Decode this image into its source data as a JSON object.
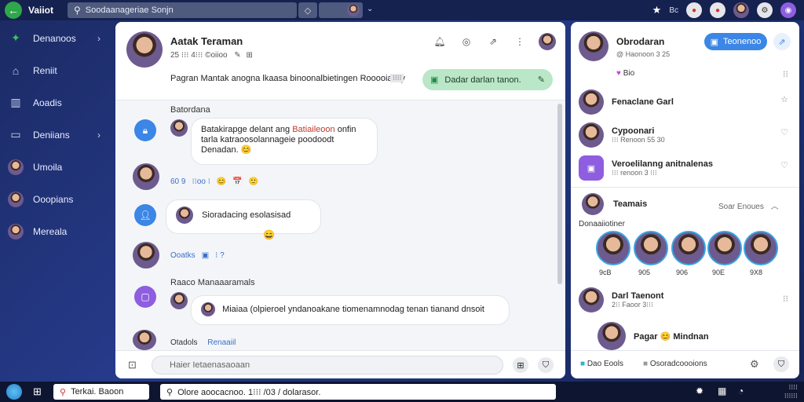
{
  "topbar": {
    "app_name": "Vaiiot",
    "search_value": "Soodaanageriae Sonjn",
    "mini_label": "◇",
    "right_badge": "Bc"
  },
  "sidebar": {
    "items": [
      {
        "label": "Denanoos",
        "icon": "puzzle-icon",
        "chevron": true
      },
      {
        "label": "Reniit",
        "icon": "home-icon",
        "chevron": false
      },
      {
        "label": "Aoadis",
        "icon": "building-icon",
        "chevron": false
      },
      {
        "label": "Deniians",
        "icon": "monitor-icon",
        "chevron": true
      },
      {
        "label": "Umoila",
        "icon": "avatar",
        "chevron": false
      },
      {
        "label": "Ooopians",
        "icon": "avatar",
        "chevron": false
      },
      {
        "label": "Mereala",
        "icon": "avatar",
        "chevron": false
      }
    ]
  },
  "chat": {
    "title": "Aatak Teraman",
    "subtitle": "25  ⁝⁝⁝ 4⁝⁝⁝   ©oiioo",
    "description": "Pagran Mantak anogna lkaasa binoonalbietingen Rooooiaully",
    "description_badge": "⁝⁝⁝⁝",
    "green_button": "Dadar darlan tanon.",
    "section1_label": "Batordana",
    "bubble1_prefix": "Batakirapge delant ang ",
    "bubble1_highlight": "Batiaileoon",
    "bubble1_rest": " onfin tarla katraoosolannageie poodoodt Denadan.",
    "bubble1_emoji": "😊",
    "react1": [
      "60  9",
      "⁝⁝oo ⁝",
      "😊",
      "📅",
      "🙂"
    ],
    "bubble2": "Sioradacing esolasisad",
    "bubble2_emoji": "😄",
    "react2": [
      "Ooatks",
      "⁝ ?"
    ],
    "section2_label": "Raaco Manaaaramals",
    "bubble3": "Miaiaa (olpieroel yndanoakane tiomenamnodag tenan tianand dnsoit",
    "footer_label": "Otadols",
    "footer_link": "Renaaiil",
    "composer_placeholder": "Haier Ietaenasaoaan"
  },
  "right": {
    "header_name": "Obrodaran",
    "header_sub": "@  Haonoon 3  25",
    "header_button": "Teonenoo",
    "reactions_count": "Bio",
    "rows": [
      {
        "name": "Fenaclane Garl",
        "sub": "",
        "icon": "star"
      },
      {
        "name": "Cypoonari",
        "sub": "⁝⁝⁝  Renoon 55  30",
        "icon": "heart"
      },
      {
        "name": "Veroelilanng anitnalenas",
        "sub": "⁝⁝⁝  renoon  3  ⁝⁝⁝",
        "icon": "heart"
      }
    ],
    "teams_label": "Teamais",
    "teams_link": "Soar Enoues",
    "stories_label": "Donaaiiotiner",
    "story_counts": [
      "9cB",
      "905",
      "906",
      "90E",
      "9X8"
    ],
    "dm_name": "Darl Taenont",
    "dm_sub": "2⁝⁝  Faoor 3⁝⁝⁝",
    "dm2_name": "Pagar 😊 Mindnan",
    "footer_left": "Dao Eools",
    "footer_right": "Osoradcoooions"
  },
  "taskbar": {
    "search1": "Terkai. Baoon",
    "search2": "Olore aoocacnoo. 1⁝⁝⁝ /03 / dolarasor.",
    "clock_time": "⁝⁝⁝⁝",
    "clock_date": "⁝⁝⁝⁝⁝⁝"
  }
}
